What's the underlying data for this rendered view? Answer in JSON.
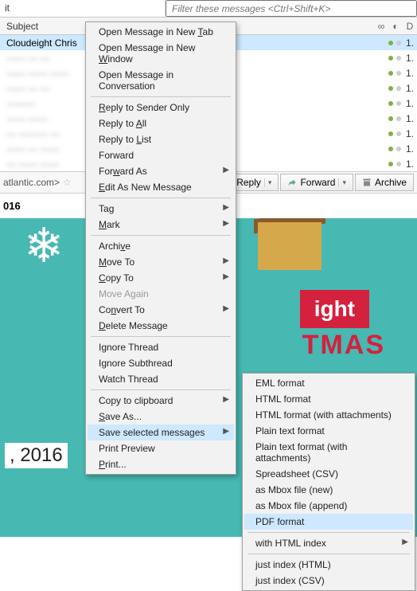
{
  "toprow": {
    "t1": "it",
    "filter_placeholder": "Filter these messages <Ctrl+Shift+K>"
  },
  "colhead": {
    "subject": "Subject",
    "date": "D"
  },
  "messages": [
    {
      "subj": "Cloudeight Chris",
      "dt": "1."
    },
    {
      "subj": "—— — —",
      "dt": "1."
    },
    {
      "subj": "—— —— ——",
      "dt": "1."
    },
    {
      "subj": "—— — —",
      "dt": "1."
    },
    {
      "subj": "———",
      "dt": "1."
    },
    {
      "subj": "—— ——",
      "dt": "1."
    },
    {
      "subj": "— ——— —",
      "dt": "1."
    },
    {
      "subj": "—— — ——",
      "dt": "1."
    },
    {
      "subj": "— —— ——",
      "dt": "1."
    }
  ],
  "infobar": {
    "from": "atlantic.com>",
    "reply": "Reply",
    "forward": "Forward",
    "archive": "Archive"
  },
  "dateline": "016",
  "preview": {
    "banner": "ight",
    "banner2": "TMAS",
    "date": ", 2016"
  },
  "ctx": {
    "open_tab_pre": "Open Message in New ",
    "open_tab_u": "T",
    "open_tab_post": "ab",
    "open_win_pre": "Open Message in New ",
    "open_win_u": "W",
    "open_win_post": "indow",
    "open_conv": "Open Message in Conversation",
    "reply_sender_u": "R",
    "reply_sender_post": "eply to Sender Only",
    "reply_all_pre": "Reply to ",
    "reply_all_u": "A",
    "reply_all_post": "ll",
    "reply_list_pre": "Reply to ",
    "reply_list_u": "L",
    "reply_list_post": "ist",
    "forward": "Forward",
    "forward_as_pre": "For",
    "forward_as_u": "w",
    "forward_as_post": "ard As",
    "edit_new_u": "E",
    "edit_new_post": "dit As New Message",
    "tag_pre": "Ta",
    "tag_u": "g",
    "mark_u": "M",
    "mark_post": "ark",
    "archive_pre": "Archi",
    "archive_u": "v",
    "archive_post": "e",
    "moveto_u": "M",
    "moveto_post": "ove To",
    "copyto_u": "C",
    "copyto_post": "opy To",
    "moveagain_pre": "Move A",
    "moveagain_u": "g",
    "moveagain_post": "ain",
    "convertto_pre": "Co",
    "convertto_u": "n",
    "convertto_post": "vert To",
    "delete_u": "D",
    "delete_post": "elete Message",
    "ignore_thread": "Ignore Thread",
    "ignore_sub": "Ignore Subthread",
    "watch": "Watch Thread",
    "copy_clip": "Copy to clipboard",
    "saveas_u": "S",
    "saveas_post": "ave As...",
    "save_sel": "Save selected messages",
    "print_prev": "Print Preview",
    "print_u": "P",
    "print_post": "rint..."
  },
  "submenu": {
    "eml": "EML format",
    "html": "HTML format",
    "html_att": "HTML format (with attachments)",
    "plain": "Plain text format",
    "plain_att": "Plain text format (with attachments)",
    "csv": "Spreadsheet (CSV)",
    "mbox_new": "as Mbox file (new)",
    "mbox_app": "as Mbox file (append)",
    "pdf": "PDF format",
    "html_idx": "with HTML index",
    "just_html": "just index (HTML)",
    "just_csv": "just index (CSV)"
  }
}
